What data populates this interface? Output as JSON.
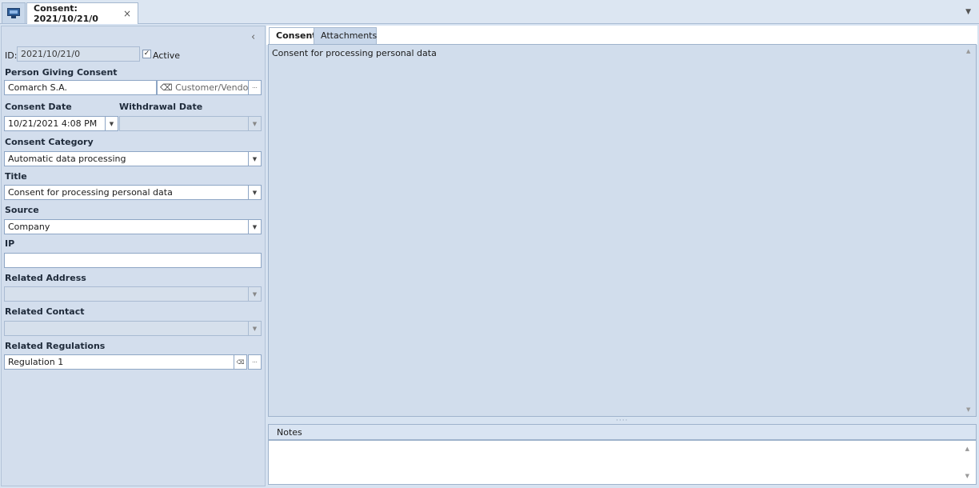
{
  "window": {
    "tab_title": "Consent: 2021/10/21/0",
    "tab_close": "×"
  },
  "form": {
    "id_label": "ID:",
    "id_value": "2021/10/21/0",
    "active_label": "Active",
    "active_checked": "✓",
    "person_label": "Person Giving Consent",
    "person_value": "Comarch S.A.",
    "person_type": "Customer/Vendor",
    "more_btn": "···",
    "consent_date_label": "Consent Date",
    "consent_date_value": "10/21/2021 4:08 PM",
    "withdrawal_date_label": "Withdrawal Date",
    "withdrawal_date_value": "",
    "category_label": "Consent Category",
    "category_value": "Automatic data processing",
    "title_label": "Title",
    "title_value": "Consent for processing personal data",
    "source_label": "Source",
    "source_value": "Company",
    "ip_label": "IP",
    "ip_value": "",
    "address_label": "Related Address",
    "address_value": "",
    "contact_label": "Related Contact",
    "contact_value": "",
    "regulations_label": "Related Regulations",
    "regulations_value": "Regulation 1"
  },
  "tabs": {
    "consent": "Consent",
    "attachments": "Attachments"
  },
  "content": {
    "text": "Consent for processing personal data"
  },
  "notes": {
    "header": "Notes",
    "value": ""
  }
}
